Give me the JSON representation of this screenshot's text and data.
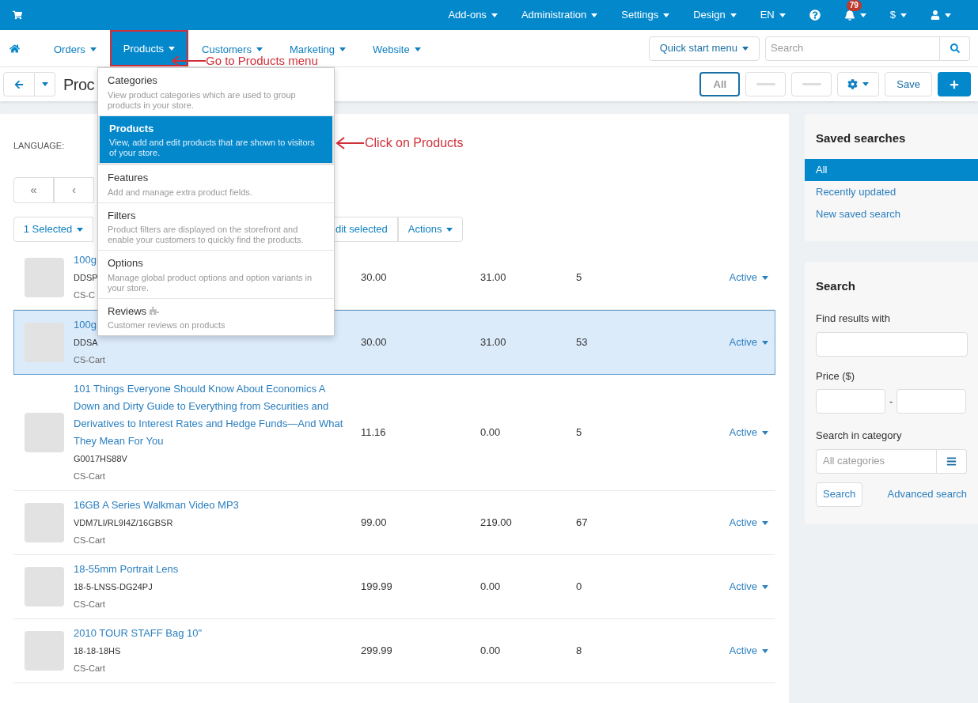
{
  "top_bar": {
    "items": [
      {
        "label": "Add-ons"
      },
      {
        "label": "Administration"
      },
      {
        "label": "Settings"
      },
      {
        "label": "Design"
      },
      {
        "label": "EN"
      }
    ],
    "notifications_count": "79",
    "currency": "$"
  },
  "main_nav": {
    "items": [
      {
        "label": "Orders",
        "selected": false,
        "annotated": false
      },
      {
        "label": "Products",
        "selected": true,
        "annotated": true
      },
      {
        "label": "Customers",
        "selected": false,
        "annotated": false
      },
      {
        "label": "Marketing",
        "selected": false,
        "annotated": false
      },
      {
        "label": "Website",
        "selected": false,
        "annotated": false
      }
    ],
    "quick_start": "Quick start menu",
    "search": {
      "placeholder": "Search"
    }
  },
  "toolbar": {
    "title": "Proc",
    "storefronts": [
      {
        "label": "All",
        "selected": true
      },
      {
        "selected": false
      },
      {
        "selected": false
      }
    ],
    "save": "Save"
  },
  "products_menu": {
    "items": [
      {
        "title": "Categories",
        "description": "View product categories which are used to group products in your store.",
        "selected": false,
        "annotated": false,
        "addon": false
      },
      {
        "title": "Products",
        "description": "View, add and edit products that are shown to visitors of your store.",
        "selected": true,
        "annotated": true,
        "addon": false
      },
      {
        "title": "Features",
        "description": "Add and manage extra product fields.",
        "selected": false,
        "annotated": false,
        "addon": false
      },
      {
        "title": "Filters",
        "description": "Product filters are displayed on the storefront and enable your customers to quickly find the products.",
        "selected": false,
        "annotated": false,
        "addon": false
      },
      {
        "title": "Options",
        "description": "Manage global product options and option variants in your store.",
        "selected": false,
        "annotated": false,
        "addon": false
      },
      {
        "title": "Reviews",
        "description": "Customer reviews on products",
        "selected": false,
        "annotated": false,
        "addon": true
      }
    ]
  },
  "annotations": [
    {
      "text": "Go to Products menu"
    },
    {
      "text": "Click on Products"
    }
  ],
  "language_label": "LANGUAGE:",
  "pagination": [
    "«",
    "‹"
  ],
  "bulk_actions": {
    "selected": "1 Selected",
    "edit": "dit selected",
    "actions": "Actions"
  },
  "table": {
    "rows": [
      {
        "name": "100g",
        "sku": "DDSP",
        "vendor": "CS-C",
        "price": "30.00",
        "list_price": "31.00",
        "quantity": "5",
        "status": "Active",
        "selected": false
      },
      {
        "name": "100g",
        "sku": "DDSA",
        "vendor": "CS-Cart",
        "price": "30.00",
        "list_price": "31.00",
        "quantity": "53",
        "status": "Active",
        "selected": true
      },
      {
        "name": "101 Things Everyone Should Know About Economics A Down and Dirty Guide to Everything from Securities and Derivatives to Interest Rates and Hedge Funds—And What They Mean For You",
        "sku": "G0017HS88V",
        "vendor": "CS-Cart",
        "price": "11.16",
        "list_price": "0.00",
        "quantity": "5",
        "status": "Active",
        "selected": false
      },
      {
        "name": "16GB A Series Walkman Video MP3",
        "sku": "VDM7LI/RL9I4Z/16GBSR",
        "vendor": "CS-Cart",
        "price": "99.00",
        "list_price": "219.00",
        "quantity": "67",
        "status": "Active",
        "selected": false
      },
      {
        "name": "18-55mm Portrait Lens",
        "sku": "18-5-LNSS-DG24PJ",
        "vendor": "CS-Cart",
        "price": "199.99",
        "list_price": "0.00",
        "quantity": "0",
        "status": "Active",
        "selected": false
      },
      {
        "name": "2010 TOUR STAFF Bag 10\"",
        "sku": "18-18-18HS",
        "vendor": "CS-Cart",
        "price": "299.99",
        "list_price": "0.00",
        "quantity": "8",
        "status": "Active",
        "selected": false
      }
    ]
  },
  "saved_searches": {
    "title": "Saved searches",
    "items": [
      {
        "label": "All",
        "selected": true
      },
      {
        "label": "Recently updated",
        "selected": false
      },
      {
        "label": "New saved search",
        "selected": false
      }
    ]
  },
  "search_panel": {
    "title": "Search",
    "find_label": "Find results with",
    "price_label": "Price ($)",
    "price_separator": "-",
    "category_label": "Search in category",
    "category_placeholder": "All categories",
    "search_button": "Search",
    "advanced_link": "Advanced search"
  }
}
